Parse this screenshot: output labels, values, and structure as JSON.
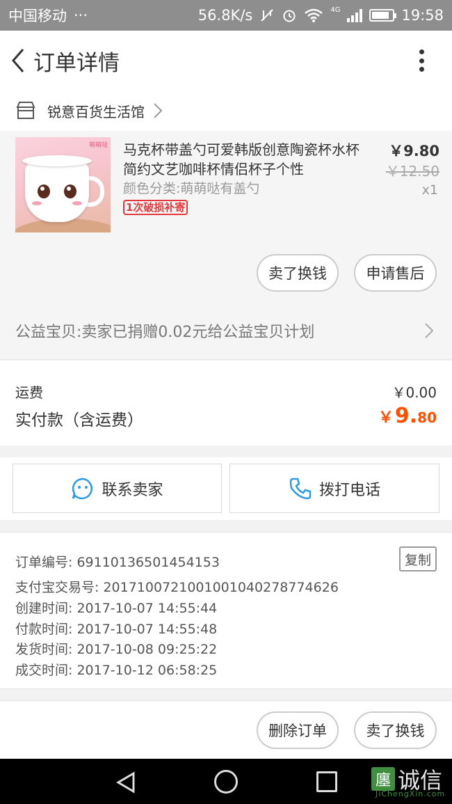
{
  "status_bar": {
    "carrier": "中国移动",
    "dots": "···",
    "speed": "56.8K/s",
    "network": "4G",
    "time": "19:58",
    "battery_level": 0.85
  },
  "header": {
    "title": "订单详情"
  },
  "shop": {
    "name": "锐意百货生活馆"
  },
  "product": {
    "thumb_tag": "萌萌哒",
    "name": "马克杯带盖勺可爱韩版创意陶瓷杯水杯简约文艺咖啡杯情侣杯子个性",
    "sku": "颜色分类:萌萌哒有盖勺",
    "badge": "1次破损补寄",
    "price": "￥9.80",
    "original_price": "￥12.50",
    "quantity": "x1",
    "actions": [
      "卖了换钱",
      "申请售后"
    ]
  },
  "charity": {
    "text": "公益宝贝:卖家已捐赠0.02元给公益宝贝计划"
  },
  "fees": {
    "shipping_label": "运费",
    "shipping_value": "￥0.00",
    "total_label": "实付款（含运费）",
    "total_currency": "￥",
    "total_int": "9.",
    "total_dec": "80"
  },
  "contact": {
    "seller": "联系卖家",
    "phone": "拨打电话"
  },
  "order_info": {
    "order_no": "订单编号: 69110136501454153",
    "copy": "复制",
    "alipay_no": "支付宝交易号: 2017100721001001040278774626",
    "created": "创建时间: 2017-10-07 14:55:44",
    "paid": "付款时间: 2017-10-07 14:55:48",
    "shipped": "发货时间: 2017-10-08 09:25:22",
    "completed": "成交时间: 2017-10-12 06:58:25"
  },
  "bottom_actions": {
    "delete": "删除订单",
    "sell": "卖了换钱"
  },
  "watermark": {
    "logo": "廛",
    "text": "诚信",
    "sub": "JiChengXin.com"
  },
  "colors": {
    "accent": "#ff5000",
    "badge": "#e4393c",
    "icon_blue": "#2a9be6"
  }
}
